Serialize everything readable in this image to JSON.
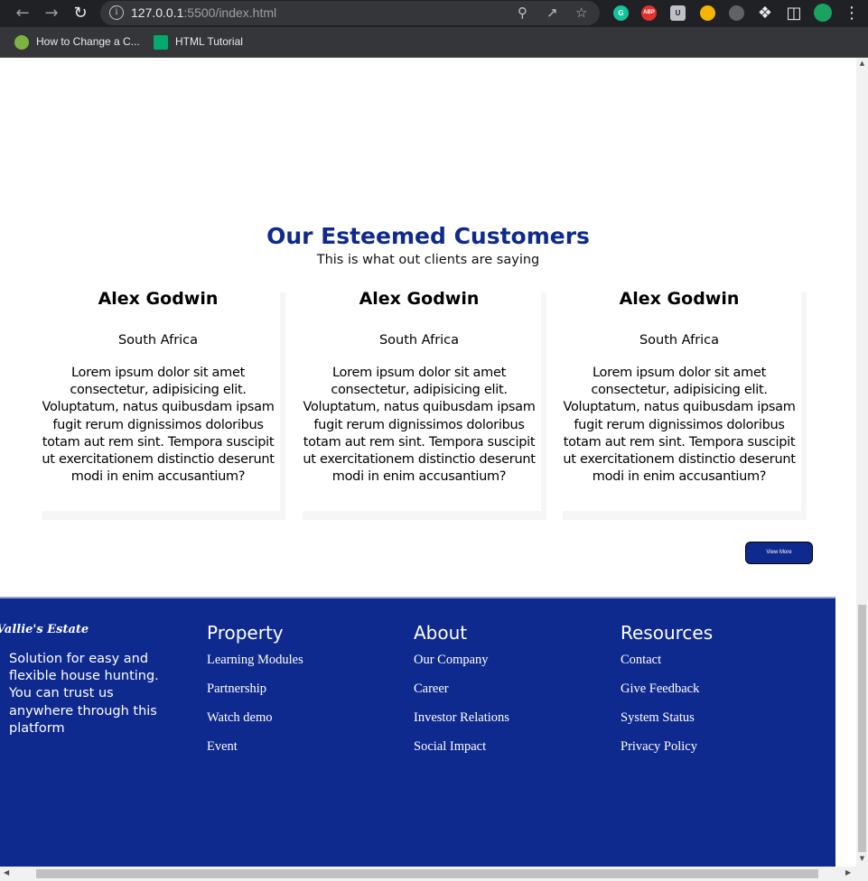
{
  "browser": {
    "url_host": "127.0.0.1",
    "url_rest": ":5500/index.html",
    "bookmarks": [
      {
        "label": "How to Change a C..."
      },
      {
        "label": "HTML Tutorial"
      }
    ],
    "extensions": [
      {
        "name": "grammarly-icon",
        "label": "G",
        "color": "#15c39a"
      },
      {
        "name": "adblock-icon",
        "label": "ABP",
        "color": "#e2322d"
      },
      {
        "name": "bitwarden-icon",
        "label": "U",
        "color": "#bdc1c6"
      },
      {
        "name": "extension-colorful-icon",
        "label": "",
        "color": "#f4b400"
      },
      {
        "name": "analytics-icon",
        "label": "",
        "color": "#5f6368"
      },
      {
        "name": "profile-avatar",
        "label": "",
        "color": "#1aa260"
      }
    ]
  },
  "testimonials": {
    "title": "Our Esteemed Customers",
    "subtitle": "This is what out clients are saying",
    "cards": [
      {
        "name": "Alex Godwin",
        "country": "South Africa",
        "quote": "Lorem ipsum dolor sit amet consectetur, adipisicing elit. Voluptatum, natus quibusdam ipsam fugit rerum dignissimos doloribus totam aut rem sint. Tempora suscipit ut exercitationem distinctio deserunt modi in enim accusantium?"
      },
      {
        "name": "Alex Godwin",
        "country": "South Africa",
        "quote": "Lorem ipsum dolor sit amet consectetur, adipisicing elit. Voluptatum, natus quibusdam ipsam fugit rerum dignissimos doloribus totam aut rem sint. Tempora suscipit ut exercitationem distinctio deserunt modi in enim accusantium?"
      },
      {
        "name": "Alex Godwin",
        "country": "South Africa",
        "quote": "Lorem ipsum dolor sit amet consectetur, adipisicing elit. Voluptatum, natus quibusdam ipsam fugit rerum dignissimos doloribus totam aut rem sint. Tempora suscipit ut exercitationem distinctio deserunt modi in enim accusantium?"
      }
    ],
    "view_more": "View More"
  },
  "footer": {
    "brand": "Vallie's Estate",
    "tagline": "Solution for easy and flexible house hunting. You can trust us anywhere through this platform",
    "columns": [
      {
        "heading": "Property",
        "links": [
          "Learning Modules",
          "Partnership",
          "Watch demo",
          "Event"
        ]
      },
      {
        "heading": "About",
        "links": [
          "Our Company",
          "Career",
          "Investor Relations",
          "Social Impact"
        ]
      },
      {
        "heading": "Resources",
        "links": [
          "Contact",
          "Give Feedback",
          "System Status",
          "Privacy Policy"
        ]
      }
    ]
  },
  "colors": {
    "brand_blue": "#0f2a8f",
    "chrome_dark": "#202124"
  }
}
